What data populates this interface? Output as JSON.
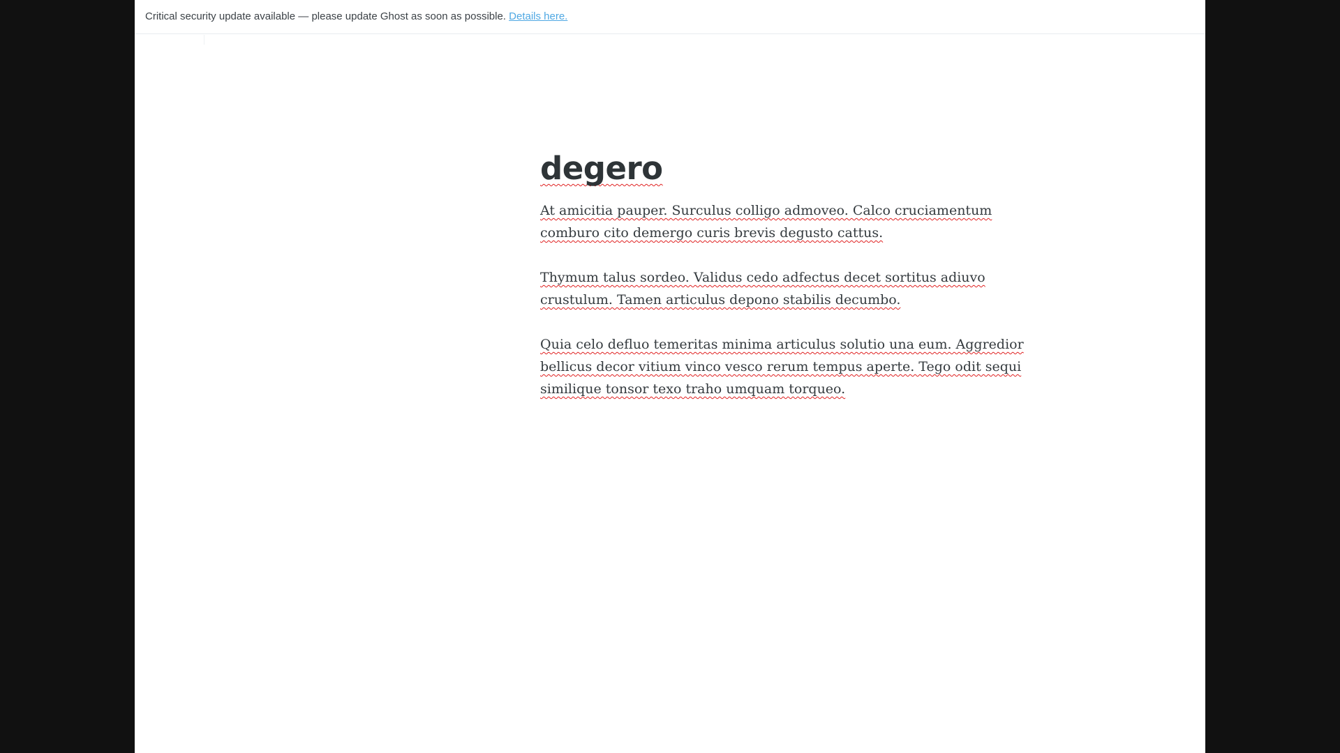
{
  "banner": {
    "message": "Critical security update available — please update Ghost as soon as possible.",
    "link_label": "Details here."
  },
  "post": {
    "title": "degero",
    "paragraphs": [
      "At amicitia pauper. Surculus colligo admoveo. Calco cruciamentum comburo cito demergo curis brevis degusto cattus.",
      "Thymum talus sordeo. Validus cedo adfectus decet sortitus adiuvo crustulum. Tamen articulus depono stabilis decumbo.",
      "Quia celo defluo temeritas minima articulus solutio una eum. Aggredior bellicus decor vitium vinco vesco rerum tempus aperte. Tego odit sequi similique tonsor texo traho umquam torqueo."
    ]
  },
  "colors": {
    "background": "#111111",
    "page": "#ffffff",
    "link": "#4fa8e3",
    "spellcheck": "#e02020"
  }
}
